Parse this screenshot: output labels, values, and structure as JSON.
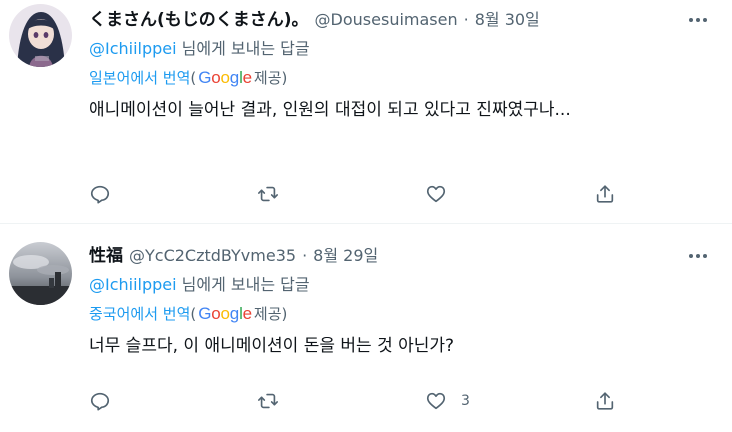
{
  "tweets": [
    {
      "name": "くまさん(もじのくまさん)。",
      "handle": "@Dousesuimasen",
      "dot": "·",
      "date": "8월 30일",
      "reply_prefix": "",
      "reply_to": "@Ichiilppei",
      "reply_suffix": " 님에게 보내는 답글",
      "translated_from": "일본어에서 번역",
      "provided_open": "(",
      "google": "Google",
      "provided_close": " 제공)",
      "text": "애니메이션이 늘어난 결과, 인원의 대접이 되고 있다고 진짜였구나...",
      "like_count": ""
    },
    {
      "name": "性福",
      "handle": "@YcC2CztdBYvme35",
      "dot": "·",
      "date": "8월 29일",
      "reply_to": "@Ichiilppei",
      "reply_suffix": " 님에게 보내는 답글",
      "translated_from": "중국어에서 번역",
      "provided_open": "(",
      "google": "Google",
      "provided_close": " 제공)",
      "text": "너무 슬프다, 이 애니메이션이 돈을 버는 것 아닌가?",
      "like_count": "3"
    }
  ],
  "icons": {
    "more": "more-dots-icon",
    "reply": "reply-bubble-icon",
    "retweet": "retweet-icon",
    "like": "heart-icon",
    "share": "share-upload-icon"
  },
  "colors": {
    "accent": "#1d9bf0",
    "secondary_text": "#536471",
    "icon": "#536471",
    "divider": "#eff3f4"
  }
}
